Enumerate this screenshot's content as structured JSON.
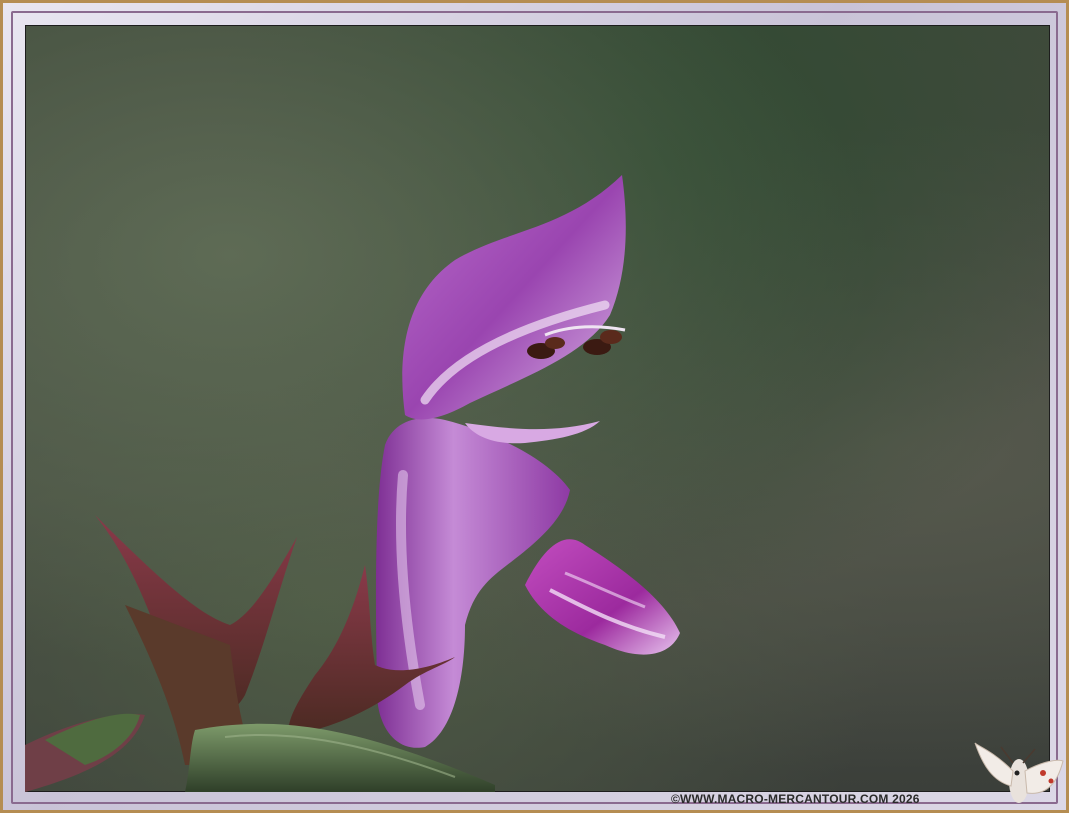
{
  "watermark": {
    "text": "©WWW.MACRO-MERCANTOUR.COM 2026"
  },
  "colors": {
    "frame_gold": "#b58d52",
    "petal_purple": "#a34fb8",
    "petal_light": "#e6c6ef",
    "background_green": "#3f4a3b"
  }
}
